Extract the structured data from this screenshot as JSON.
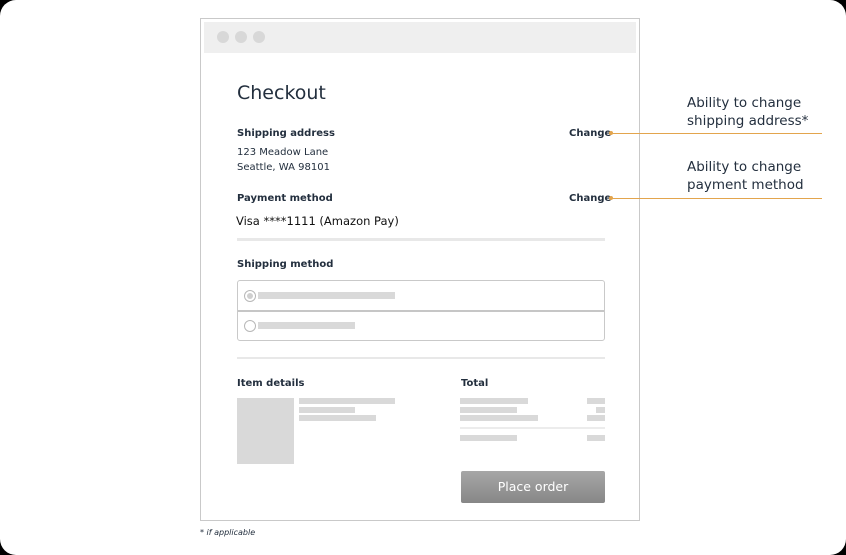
{
  "window": {
    "controls": [
      "close-dot",
      "minimize-dot",
      "maximize-dot"
    ]
  },
  "checkout": {
    "title": "Checkout",
    "shipping_address": {
      "label": "Shipping address",
      "line1": "123 Meadow Lane",
      "line2": "Seattle, WA 98101",
      "change_label": "Change"
    },
    "payment_method": {
      "label": "Payment method",
      "value": "Visa ****1111 (Amazon Pay)",
      "change_label": "Change"
    },
    "shipping_method": {
      "label": "Shipping method",
      "options": [
        {
          "selected": true,
          "placeholder": true
        },
        {
          "selected": false,
          "placeholder": true
        }
      ]
    },
    "item_details": {
      "label": "Item details"
    },
    "total": {
      "label": "Total"
    },
    "place_order_label": "Place order"
  },
  "annotations": [
    {
      "line1": "Ability to change",
      "line2": "shipping address*",
      "target": "shipping-address-change"
    },
    {
      "line1": "Ability to change",
      "line2": "payment method",
      "target": "payment-method-change"
    }
  ],
  "footnote": "* if applicable",
  "colors": {
    "accent_leader": "#e3a54d",
    "text_dark": "#232f3e",
    "placeholder": "#d9d9d9",
    "button": "#949494"
  }
}
